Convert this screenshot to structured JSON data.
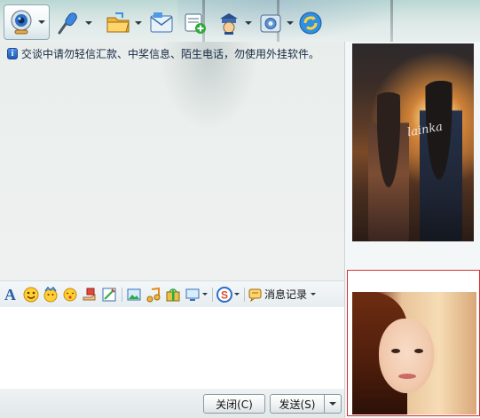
{
  "toolbar": {
    "buttons": [
      {
        "id": "video",
        "icon": "webcam-icon",
        "has_dropdown": true,
        "active": true
      },
      {
        "id": "voice",
        "icon": "microphone-icon",
        "has_dropdown": true
      },
      {
        "id": "file",
        "icon": "folder-icon",
        "has_dropdown": true
      },
      {
        "id": "sms",
        "icon": "mail-icon",
        "has_dropdown": false
      },
      {
        "id": "add",
        "icon": "add-app-icon",
        "has_dropdown": false
      },
      {
        "id": "remote",
        "icon": "remote-assist-icon",
        "has_dropdown": true
      },
      {
        "id": "settings",
        "icon": "settings-icon",
        "has_dropdown": true
      },
      {
        "id": "refresh",
        "icon": "refresh-icon",
        "has_dropdown": false
      }
    ]
  },
  "message": {
    "notice": "交谈中请勿轻信汇款、中奖信息、陌生电话，勿使用外挂软件。"
  },
  "format_bar": {
    "items": [
      "font-icon",
      "smiley-icon",
      "magic-face-icon",
      "shake-icon",
      "gift-hand-icon",
      "screenshot-icon",
      "image-icon",
      "music-icon",
      "gift-box-icon",
      "screen-share-icon",
      "s-icon"
    ],
    "history_label": "消息记录"
  },
  "bottom": {
    "close_label": "关闭(C)",
    "send_label": "发送(S)"
  },
  "right_panel": {
    "top_photo_watermark": "lainka"
  },
  "colors": {
    "accent": "#2f6fc4",
    "selected_border": "#d93030"
  }
}
